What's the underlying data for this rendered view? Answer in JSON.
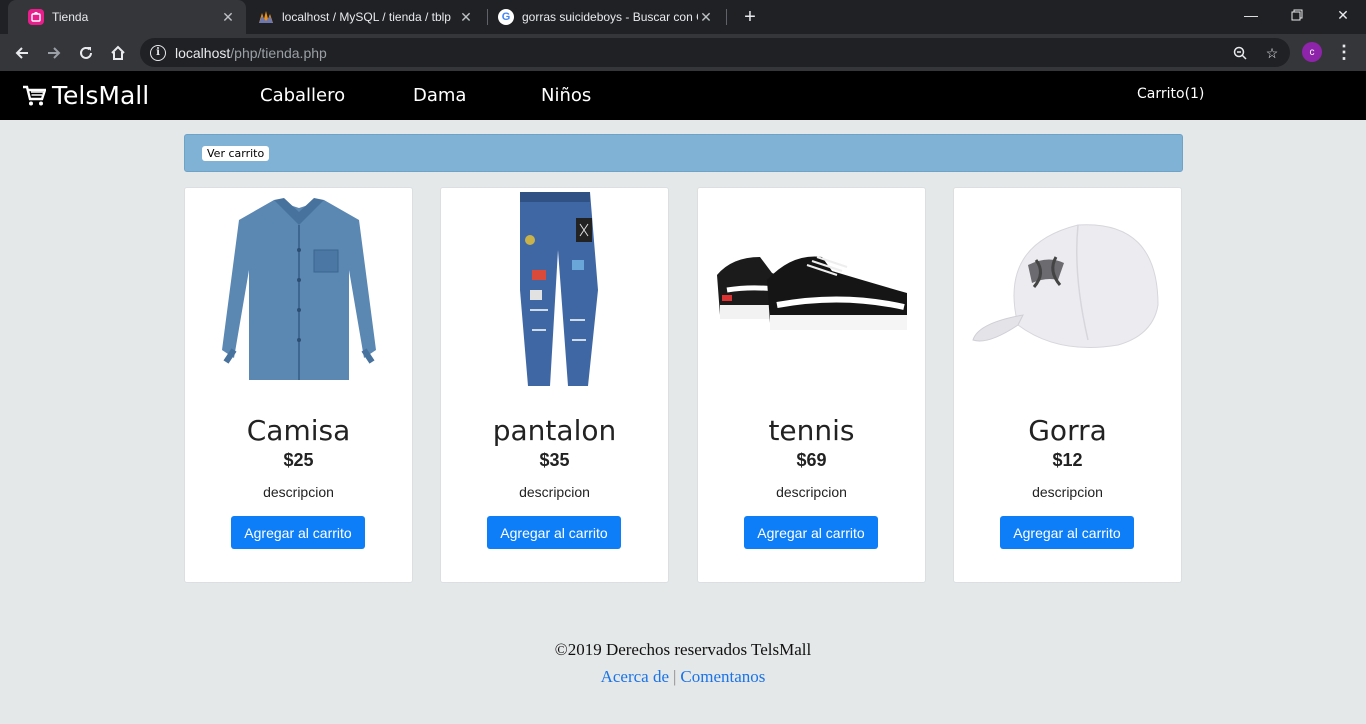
{
  "browser": {
    "tabs": [
      {
        "title": "Tienda",
        "icon": "tienda-favicon",
        "active": true
      },
      {
        "title": "localhost / MySQL / tienda / tblp",
        "icon": "phpmyadmin-favicon",
        "active": false
      },
      {
        "title": "gorras suicideboys - Buscar con G",
        "icon": "google-favicon",
        "active": false
      }
    ],
    "url_host": "localhost",
    "url_path": "/php/tienda.php",
    "profile_initial": "c"
  },
  "site": {
    "brand": "TelsMall",
    "nav": [
      "Caballero",
      "Dama",
      "Niños"
    ],
    "cart_label": "Carrito(1)"
  },
  "alert": {
    "button_label": "Ver carrito",
    "color": "#7fb2d5"
  },
  "products": [
    {
      "name": "Camisa",
      "price": "$25",
      "description": "descripcion",
      "button": "Agregar al carrito",
      "image": "denim-shirt-image"
    },
    {
      "name": "pantalon",
      "price": "$35",
      "description": "descripcion",
      "button": "Agregar al carrito",
      "image": "ripped-jeans-image"
    },
    {
      "name": "tennis",
      "price": "$69",
      "description": "descripcion",
      "button": "Agregar al carrito",
      "image": "sneakers-image"
    },
    {
      "name": "Gorra",
      "price": "$12",
      "description": "descripcion",
      "button": "Agregar al carrito",
      "image": "white-cap-image"
    }
  ],
  "footer": {
    "copyright": "©2019 Derechos reservados TelsMall",
    "link_about": "Acerca de",
    "separator": "|",
    "link_comments": "Comentanos"
  },
  "colors": {
    "button_blue": "#0d7ef7",
    "link_blue": "#1a73e8",
    "page_bg": "#e5e8e9"
  }
}
